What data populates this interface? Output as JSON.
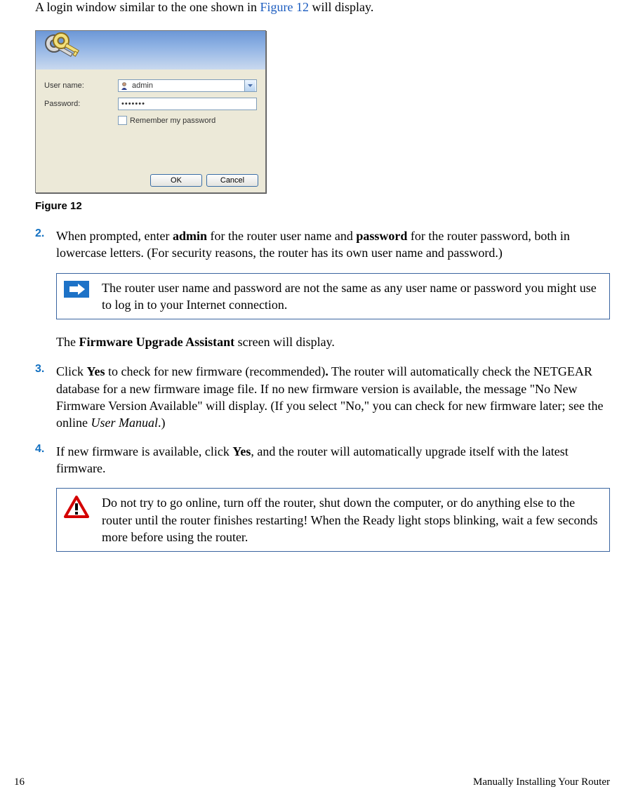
{
  "intro_pre": "A login window similar to the one shown in ",
  "intro_link": "Figure 12",
  "intro_post": " will display.",
  "login": {
    "user_label": "User name:",
    "password_label": "Password:",
    "user_value": "admin",
    "password_dots": "•••••••",
    "remember_label": "Remember my password",
    "ok": "OK",
    "cancel": "Cancel"
  },
  "figure_caption": "Figure 12",
  "step2": {
    "num": "2.",
    "t1": "When prompted, enter ",
    "b1": "admin",
    "t2": " for the router user name and ",
    "b2": "password",
    "t3": " for the router password, both in lowercase letters. (For security reasons, the router has its own user name and password.)"
  },
  "note1": "The router user name and password are not the same as any user name or password you might use to log in to your Internet connection.",
  "mid_t1": "The ",
  "mid_b": "Firmware Upgrade Assistant",
  "mid_t2": " screen will display.",
  "step3": {
    "num": "3.",
    "t1": "Click ",
    "b1": "Yes",
    "t2": " to check for new firmware (recommended)",
    "b2": ".",
    "t3": " The router will automatically check the NETGEAR database for a new firmware image file. If no new firmware version is available, the message \"No New Firmware Version Available\" will display. (If you select \"No,\" you can check for new firmware later; see the online ",
    "i1": "User Manual",
    "t4": ".)"
  },
  "step4": {
    "num": "4.",
    "t1": "If new firmware is available, click ",
    "b1": "Yes",
    "t2": ", and the router will automatically upgrade itself with the latest firmware."
  },
  "warn": "Do not try to go online, turn off the router, shut down the computer, or do anything else to the router until the router finishes restarting! When the Ready light stops blinking, wait a few seconds more before using the router.",
  "footer_page": "16",
  "footer_section": "Manually Installing Your Router"
}
